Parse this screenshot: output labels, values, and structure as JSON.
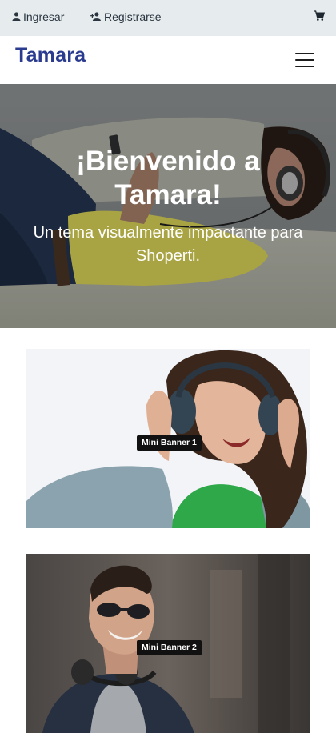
{
  "topbar": {
    "login_label": "Ingresar",
    "register_label": "Registrarse",
    "cart_icon": "cart-icon"
  },
  "header": {
    "logo": "Tamara",
    "menu_icon": "hamburger-menu-icon"
  },
  "hero": {
    "title": "¡Bienvenido a Tamara!",
    "subtitle": "Un tema visualmente impactante para Shoperti."
  },
  "banners": [
    {
      "label": "Mini Banner 1"
    },
    {
      "label": "Mini Banner 2"
    }
  ],
  "colors": {
    "topbar_bg": "#e6ecee",
    "logo": "#2b3b8f",
    "badge_bg": "#111111"
  }
}
